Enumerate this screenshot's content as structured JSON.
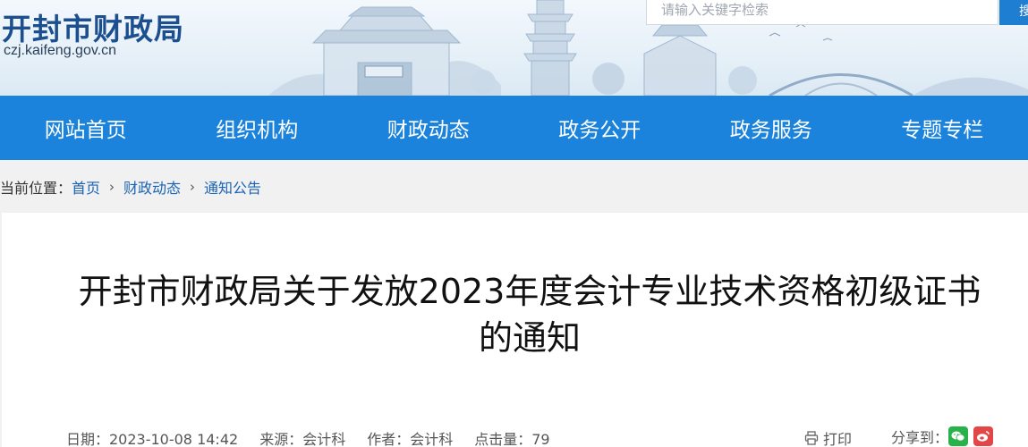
{
  "header": {
    "site_title": "开封市财政局",
    "site_domain": "czj.kaifeng.gov.cn",
    "search_placeholder": "请输入关键字检索",
    "search_button_label": "搜"
  },
  "nav": {
    "items": [
      {
        "label": "网站首页"
      },
      {
        "label": "组织机构"
      },
      {
        "label": "财政动态"
      },
      {
        "label": "政务公开"
      },
      {
        "label": "政务服务"
      },
      {
        "label": "专题专栏"
      }
    ]
  },
  "breadcrumb": {
    "prefix": "当前位置：",
    "items": [
      {
        "label": "首页"
      },
      {
        "label": "财政动态"
      },
      {
        "label": "通知公告"
      }
    ],
    "separator": "›"
  },
  "article": {
    "title_line1": "开封市财政局关于发放2023年度会计专业技术资格初级证书",
    "title_line2": "的通知",
    "meta": {
      "date": "日期：2023-10-08 14:42",
      "source": "来源：会计科",
      "author": "作者：会计科",
      "views": "点击量：79"
    },
    "print_label": "打印",
    "share_label": "分享到："
  },
  "colors": {
    "nav_bg": "#1b83dc",
    "title_blue": "#1b4f8f",
    "link_blue": "#1a63b5",
    "wechat_green": "#27b24a",
    "weibo_red": "#e24646"
  }
}
